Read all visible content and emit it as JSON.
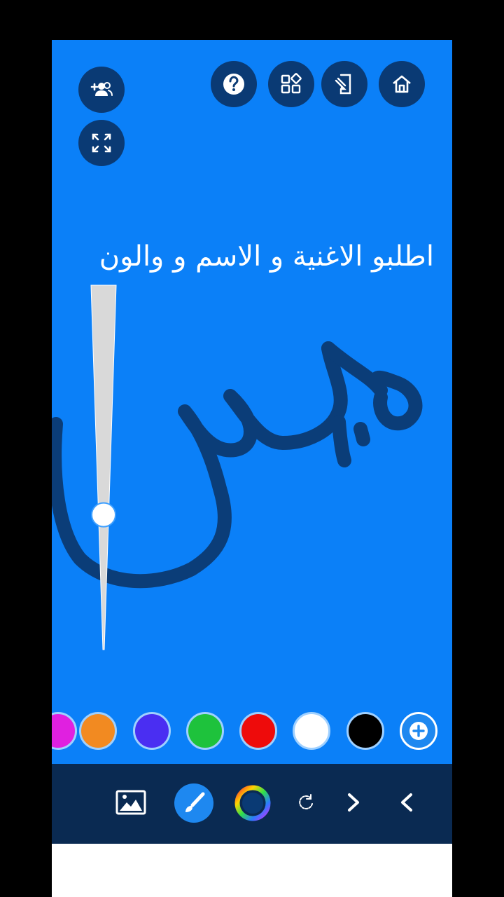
{
  "headline": "اطلبو الاغنية و الاسم و والون",
  "top_buttons": [
    {
      "name": "add-friends-button",
      "icon": "add-people-icon"
    },
    {
      "name": "fullscreen-button",
      "icon": "expand-icon"
    },
    {
      "name": "help-button",
      "icon": "question-icon"
    },
    {
      "name": "widgets-button",
      "icon": "widgets-icon"
    },
    {
      "name": "screen-button",
      "icon": "phone-edit-icon"
    },
    {
      "name": "home-button",
      "icon": "home-icon"
    }
  ],
  "brush_size_level": 0.63,
  "palette": [
    {
      "name": "magenta",
      "color": "#e020e0"
    },
    {
      "name": "orange",
      "color": "#f28a21"
    },
    {
      "name": "indigo",
      "color": "#4a2ef2"
    },
    {
      "name": "green",
      "color": "#1ec23c"
    },
    {
      "name": "red",
      "color": "#ee0b0b"
    },
    {
      "name": "white",
      "color": "#ffffff"
    },
    {
      "name": "black",
      "color": "#000000"
    }
  ],
  "toolbar": [
    {
      "name": "image-tool",
      "icon": "image-icon"
    },
    {
      "name": "brush-tool",
      "icon": "brush-icon",
      "active": true
    },
    {
      "name": "color-picker",
      "icon": "color-wheel-icon"
    },
    {
      "name": "rotate-tool",
      "icon": "rotate-icon"
    },
    {
      "name": "redo-button",
      "icon": "chevron-right-icon"
    },
    {
      "name": "undo-button",
      "icon": "chevron-left-icon"
    }
  ],
  "colors": {
    "canvas": "#0b80f8",
    "ink": "#0b3d78",
    "button": "#0a3a74",
    "toolbar": "#0a2a52",
    "accent": "#1e88f0"
  }
}
